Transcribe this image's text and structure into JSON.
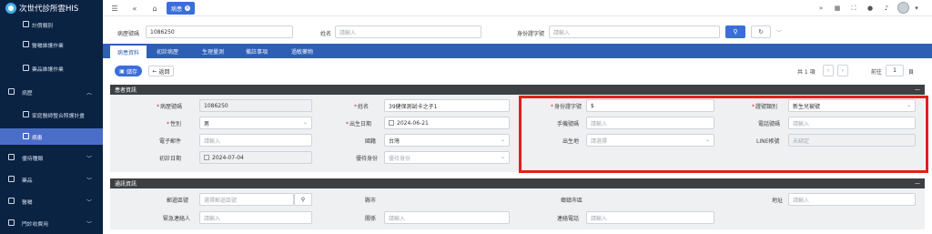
{
  "app": {
    "title": "次世代診所雲HIS"
  },
  "sidebar": {
    "items": [
      {
        "label": "計價類別"
      },
      {
        "label": "醫囑維護作業"
      },
      {
        "label": "藥品維護作業"
      },
      {
        "label": "病歷"
      },
      {
        "label": "家庭醫師整合照護計畫"
      },
      {
        "label": "病患"
      },
      {
        "label": "優待種類"
      },
      {
        "label": "藥品"
      },
      {
        "label": "醫囑"
      },
      {
        "label": "門診收費用"
      }
    ]
  },
  "topbar": {
    "tab_label": "病患"
  },
  "search": {
    "chart_no_label": "病歷號碼",
    "chart_no_value": "1086250",
    "name_label": "姓名",
    "name_placeholder": "請輸入",
    "id_label": "身份證字號",
    "id_placeholder": "請輸入"
  },
  "tabs": [
    {
      "label": "病患資料"
    },
    {
      "label": "初診病歷"
    },
    {
      "label": "生理量測"
    },
    {
      "label": "備註事項"
    },
    {
      "label": "過敏藥物"
    }
  ],
  "actions": {
    "save_label": "儲存",
    "back_label": "返回"
  },
  "pager": {
    "total_text": "共 1 項",
    "goto_label": "前往",
    "page_value": "1",
    "page_unit": "頁"
  },
  "patient_panel": {
    "title": "患者資訊",
    "fields": {
      "chart_no": {
        "label": "病歷號碼",
        "value": "1086250"
      },
      "name": {
        "label": "姓名",
        "value": "39健保測試卡之子1"
      },
      "id_no": {
        "label": "身份證字號",
        "value": "$"
      },
      "category": {
        "label": "證號類別",
        "value": "新生兒被號"
      },
      "gender": {
        "label": "性別",
        "value": "男"
      },
      "birthday": {
        "label": "出生日期",
        "value": "2024-06-21"
      },
      "mobile": {
        "label": "手機號碼",
        "placeholder": "請輸入"
      },
      "phone": {
        "label": "電話號碼",
        "placeholder": "請輸入"
      },
      "email": {
        "label": "電子郵件",
        "placeholder": "請輸入"
      },
      "nationality": {
        "label": "國籍",
        "value": "台灣"
      },
      "birthplace": {
        "label": "出生地",
        "placeholder": "請選擇"
      },
      "line": {
        "label": "LINE帳號",
        "value": "未綁定"
      },
      "first_visit": {
        "label": "初診日期",
        "value": "2024-07-04"
      },
      "discount": {
        "label": "優待身份",
        "placeholder": "優待身份"
      }
    }
  },
  "contact_panel": {
    "title": "通訊資訊",
    "fields": {
      "zip": {
        "label": "郵遞區號",
        "placeholder": "選擇郵遞區號"
      },
      "city": {
        "label": "縣市"
      },
      "district": {
        "label": "鄉鎮市區"
      },
      "address": {
        "label": "地址",
        "placeholder": "請輸入"
      },
      "emergency_contact": {
        "label": "緊急連絡人",
        "placeholder": "請輸入"
      },
      "relation": {
        "label": "關係",
        "placeholder": "請輸入"
      },
      "contact_phone": {
        "label": "連絡電話",
        "placeholder": "請輸入"
      }
    }
  }
}
